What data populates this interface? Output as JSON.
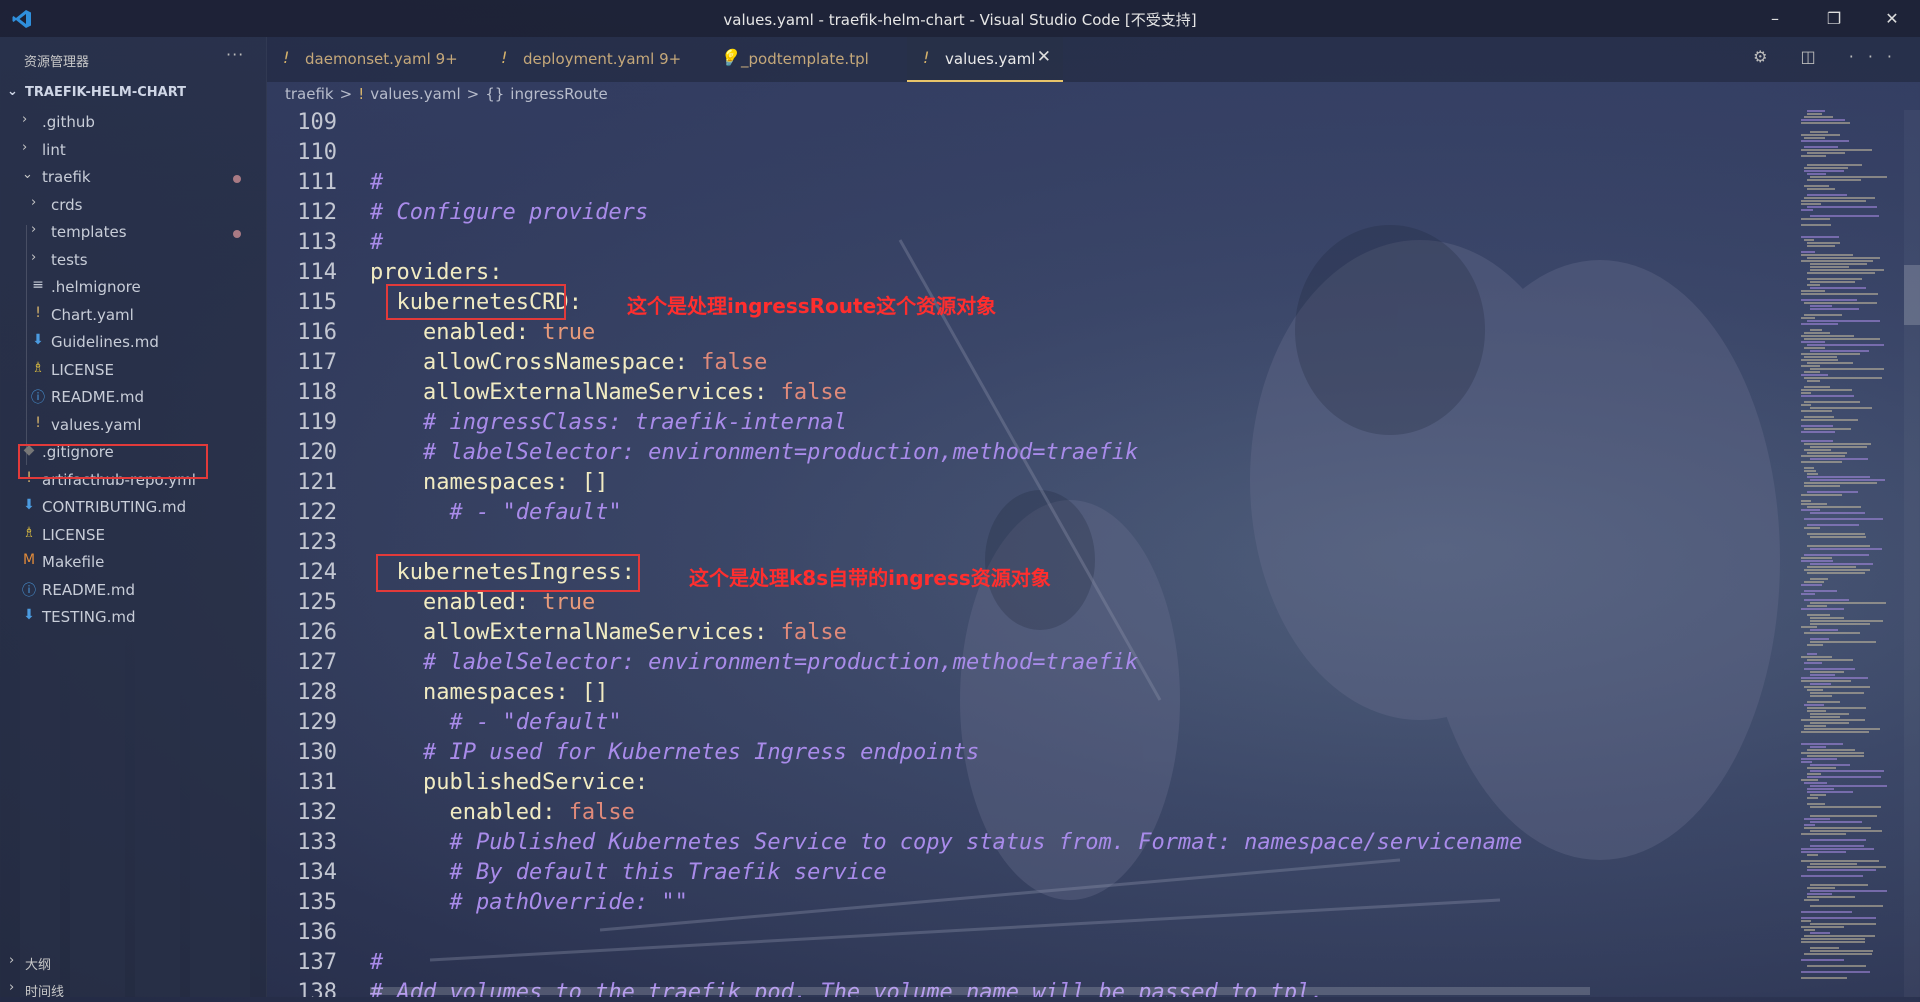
{
  "window": {
    "title": "values.yaml - traefik-helm-chart - Visual Studio Code [不受支持]",
    "minimize_glyph": "–",
    "restore_glyph": "❐",
    "close_glyph": "✕"
  },
  "sidebar": {
    "header": "资源管理器",
    "more": "···",
    "root": "TRAEFIK-HELM-CHART",
    "items": [
      {
        "label": ".github",
        "kind": "folder",
        "expanded": false,
        "icon": "chevron-right-icon"
      },
      {
        "label": "lint",
        "kind": "folder",
        "expanded": false,
        "icon": "chevron-right-icon"
      },
      {
        "label": "traefik",
        "kind": "folder",
        "expanded": true,
        "icon": "chevron-down-icon"
      },
      {
        "label": "crds",
        "kind": "folder",
        "expanded": false,
        "icon": "chevron-right-icon"
      },
      {
        "label": "templates",
        "kind": "folder",
        "expanded": false,
        "icon": "chevron-right-icon"
      },
      {
        "label": "tests",
        "kind": "folder",
        "expanded": false,
        "icon": "chevron-right-icon"
      },
      {
        "label": ".helmignore",
        "kind": "file",
        "icon": "lines-file-icon",
        "glyph": "≡",
        "color": "#c8cdd8"
      },
      {
        "label": "Chart.yaml",
        "kind": "file",
        "icon": "yaml-file-icon",
        "glyph": "!",
        "color": "#d6b36b"
      },
      {
        "label": "Guidelines.md",
        "kind": "file",
        "icon": "markdown-file-icon",
        "glyph": "⬇",
        "color": "#4b9be0"
      },
      {
        "label": "LICENSE",
        "kind": "file",
        "icon": "license-file-icon",
        "glyph": "♗",
        "color": "#e0c040"
      },
      {
        "label": "README.md",
        "kind": "file",
        "icon": "info-file-icon",
        "glyph": "ⓘ",
        "color": "#4b9be0"
      },
      {
        "label": "values.yaml",
        "kind": "file",
        "icon": "yaml-file-icon",
        "glyph": "!",
        "color": "#d6b36b"
      },
      {
        "label": ".gitignore",
        "kind": "file",
        "icon": "git-file-icon",
        "glyph": "◆",
        "color": "#777"
      },
      {
        "label": "artifacthub-repo.yml",
        "kind": "file",
        "icon": "yaml-file-icon",
        "glyph": "!",
        "color": "#d6b36b"
      },
      {
        "label": "CONTRIBUTING.md",
        "kind": "file",
        "icon": "markdown-file-icon",
        "glyph": "⬇",
        "color": "#4b9be0"
      },
      {
        "label": "LICENSE",
        "kind": "file",
        "icon": "license-file-icon",
        "glyph": "♗",
        "color": "#e0c040"
      },
      {
        "label": "Makefile",
        "kind": "file",
        "icon": "makefile-icon",
        "glyph": "M",
        "color": "#e08a3a"
      },
      {
        "label": "README.md",
        "kind": "file",
        "icon": "info-file-icon",
        "glyph": "ⓘ",
        "color": "#4b9be0"
      },
      {
        "label": "TESTING.md",
        "kind": "file",
        "icon": "markdown-file-icon",
        "glyph": "⬇",
        "color": "#4b9be0"
      }
    ],
    "outline": "大纲",
    "timeline": "时间线"
  },
  "tabs": [
    {
      "label": "daemonset.yaml",
      "badge": "9+",
      "glyph": "!"
    },
    {
      "label": "deployment.yaml",
      "badge": "9+",
      "glyph": "!"
    },
    {
      "label": "_podtemplate.tpl",
      "badge": "",
      "glyph": "💡"
    },
    {
      "label": "values.yaml",
      "badge": "",
      "glyph": "!",
      "active": true,
      "close": "✕"
    }
  ],
  "tab_actions": "⚙ ◫ ···",
  "breadcrumb": {
    "parts": [
      "traefik",
      ">",
      "!",
      "values.yaml",
      ">",
      "{}",
      "ingressRoute"
    ]
  },
  "editor": {
    "lines": [
      {
        "n": "109",
        "tokens": []
      },
      {
        "n": "110",
        "tokens": []
      },
      {
        "n": "111",
        "tokens": [
          {
            "t": "#",
            "c": "c"
          }
        ]
      },
      {
        "n": "112",
        "tokens": [
          {
            "t": "# Configure providers",
            "c": "c"
          }
        ]
      },
      {
        "n": "113",
        "tokens": [
          {
            "t": "#",
            "c": "c"
          }
        ]
      },
      {
        "n": "114",
        "tokens": [
          {
            "t": "providers",
            "c": "k"
          },
          {
            "t": ":",
            "c": "p"
          }
        ]
      },
      {
        "n": "115",
        "tokens": [
          {
            "t": "  kubernetesCRD",
            "c": "k"
          },
          {
            "t": ":",
            "c": "p"
          }
        ]
      },
      {
        "n": "116",
        "tokens": [
          {
            "t": "    enabled",
            "c": "k"
          },
          {
            "t": ": ",
            "c": "p"
          },
          {
            "t": "true",
            "c": "s"
          }
        ]
      },
      {
        "n": "117",
        "tokens": [
          {
            "t": "    allowCrossNamespace",
            "c": "k"
          },
          {
            "t": ": ",
            "c": "p"
          },
          {
            "t": "false",
            "c": "s"
          }
        ]
      },
      {
        "n": "118",
        "tokens": [
          {
            "t": "    allowExternalNameServices",
            "c": "k"
          },
          {
            "t": ": ",
            "c": "p"
          },
          {
            "t": "false",
            "c": "s"
          }
        ]
      },
      {
        "n": "119",
        "tokens": [
          {
            "t": "    # ingressClass: traefik-internal",
            "c": "c"
          }
        ]
      },
      {
        "n": "120",
        "tokens": [
          {
            "t": "    # labelSelector: environment=production,method=traefik",
            "c": "c"
          }
        ]
      },
      {
        "n": "121",
        "tokens": [
          {
            "t": "    namespaces",
            "c": "k"
          },
          {
            "t": ": []",
            "c": "p"
          }
        ]
      },
      {
        "n": "122",
        "tokens": [
          {
            "t": "      # - \"default\"",
            "c": "c"
          }
        ]
      },
      {
        "n": "123",
        "tokens": []
      },
      {
        "n": "124",
        "tokens": [
          {
            "t": "  kubernetesIngress",
            "c": "k"
          },
          {
            "t": ":",
            "c": "p"
          }
        ]
      },
      {
        "n": "125",
        "tokens": [
          {
            "t": "    enabled",
            "c": "k"
          },
          {
            "t": ": ",
            "c": "p"
          },
          {
            "t": "true",
            "c": "s"
          }
        ]
      },
      {
        "n": "126",
        "tokens": [
          {
            "t": "    allowExternalNameServices",
            "c": "k"
          },
          {
            "t": ": ",
            "c": "p"
          },
          {
            "t": "false",
            "c": "s"
          }
        ]
      },
      {
        "n": "127",
        "tokens": [
          {
            "t": "    # labelSelector: environment=production,method=traefik",
            "c": "c"
          }
        ]
      },
      {
        "n": "128",
        "tokens": [
          {
            "t": "    namespaces",
            "c": "k"
          },
          {
            "t": ": []",
            "c": "p"
          }
        ]
      },
      {
        "n": "129",
        "tokens": [
          {
            "t": "      # - \"default\"",
            "c": "c"
          }
        ]
      },
      {
        "n": "130",
        "tokens": [
          {
            "t": "    # IP used for Kubernetes Ingress endpoints",
            "c": "c"
          }
        ]
      },
      {
        "n": "131",
        "tokens": [
          {
            "t": "    publishedService",
            "c": "k"
          },
          {
            "t": ":",
            "c": "p"
          }
        ]
      },
      {
        "n": "132",
        "tokens": [
          {
            "t": "      enabled",
            "c": "k"
          },
          {
            "t": ": ",
            "c": "p"
          },
          {
            "t": "false",
            "c": "s"
          }
        ]
      },
      {
        "n": "133",
        "tokens": [
          {
            "t": "      # Published Kubernetes Service to copy status from. Format: namespace/servicename",
            "c": "c"
          }
        ]
      },
      {
        "n": "134",
        "tokens": [
          {
            "t": "      # By default this Traefik service",
            "c": "c"
          }
        ]
      },
      {
        "n": "135",
        "tokens": [
          {
            "t": "      # pathOverride: \"\"",
            "c": "c"
          }
        ]
      },
      {
        "n": "136",
        "tokens": []
      },
      {
        "n": "137",
        "tokens": [
          {
            "t": "#",
            "c": "c"
          }
        ]
      },
      {
        "n": "138",
        "tokens": [
          {
            "t": "# Add volumes to the traefik pod. The volume name will be passed to tpl.",
            "c": "c"
          }
        ]
      }
    ],
    "annotations": {
      "crd": "这个是处理ingressRoute这个资源对象",
      "ingress": "这个是处理k8s自带的ingress资源对象"
    }
  },
  "colors": {
    "annotation_red": "#ff2e2e",
    "yaml_key": "#f1ebc2",
    "yaml_value": "#e89a7a",
    "comment": "#a98bea",
    "active_tab_border": "#e8c46a"
  }
}
